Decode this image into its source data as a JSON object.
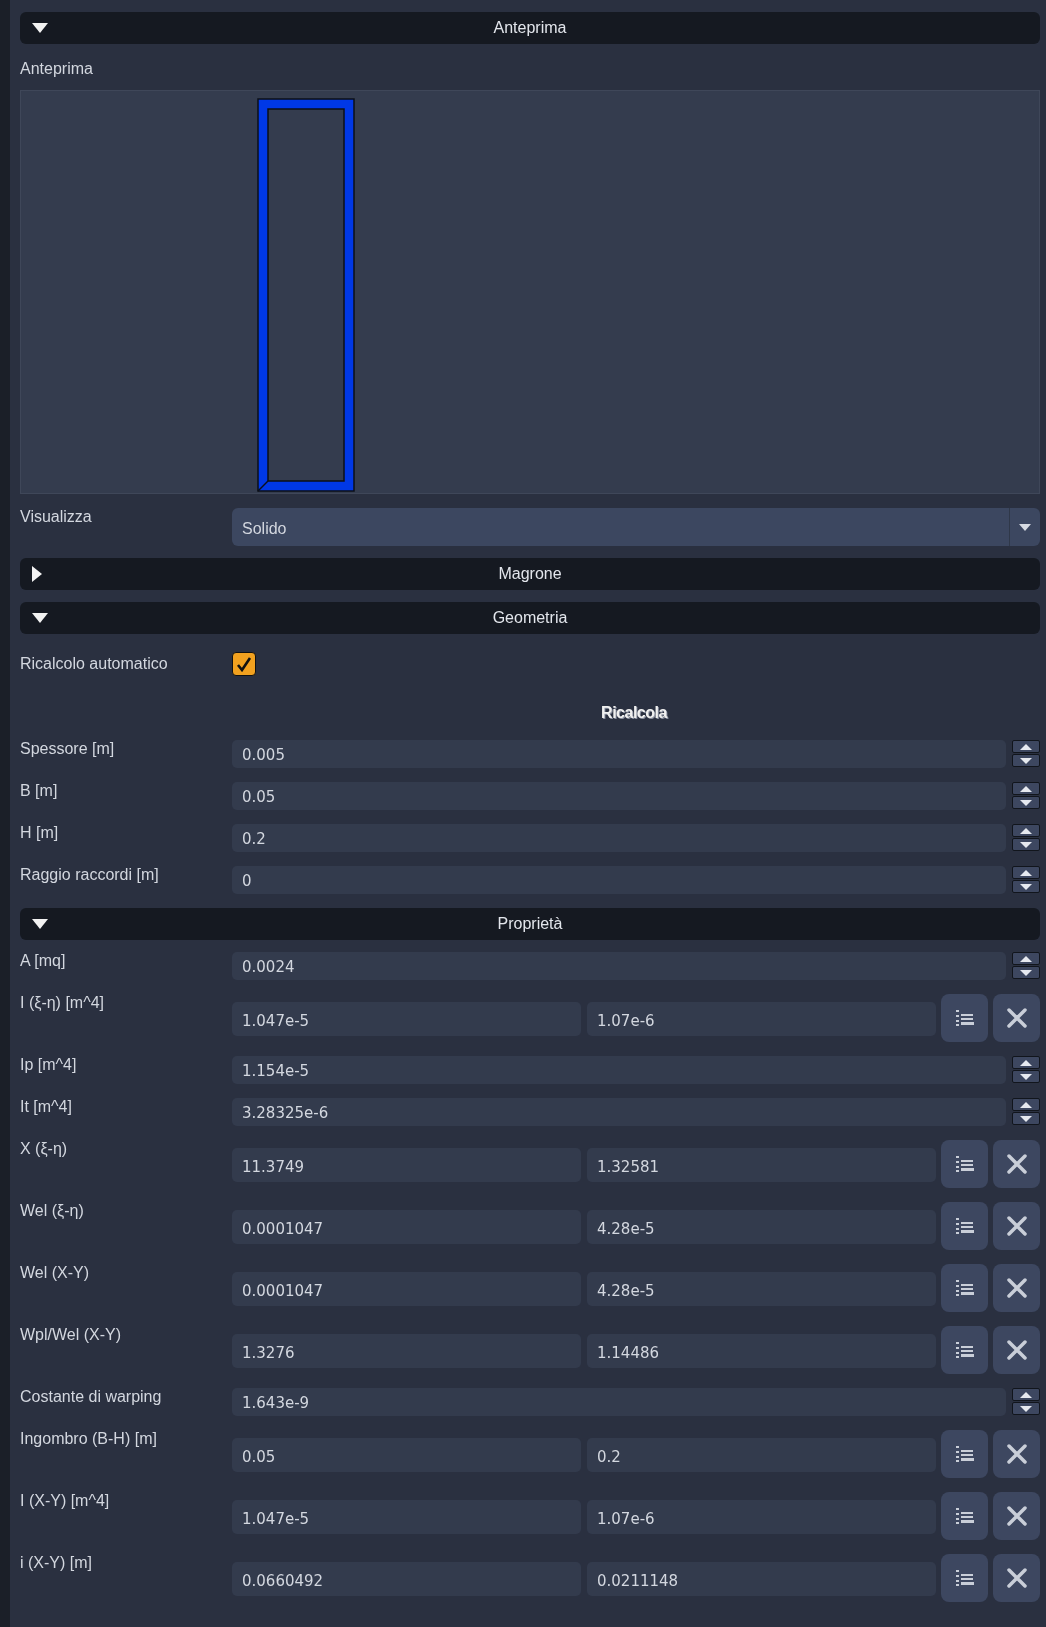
{
  "sections": [
    {
      "title": "Anteprima",
      "expanded": true,
      "rows": [
        {
          "kind": "preview",
          "label": "Anteprima"
        },
        {
          "kind": "combo",
          "label": "Visualizza",
          "value": "Solido"
        }
      ]
    },
    {
      "title": "Magrone",
      "expanded": false
    },
    {
      "title": "Geometria",
      "expanded": true,
      "rows": [
        {
          "kind": "checkbox",
          "label": "Ricalcolo automatico",
          "checked": true
        },
        {
          "kind": "button",
          "label": "Ricalcola"
        },
        {
          "kind": "spin",
          "label": "Spessore [m]",
          "value": "0.005"
        },
        {
          "kind": "spin",
          "label": "B [m]",
          "value": "0.05"
        },
        {
          "kind": "spin",
          "label": "H [m]",
          "value": "0.2"
        },
        {
          "kind": "spin",
          "label": "Raggio raccordi [m]",
          "value": "0"
        }
      ]
    },
    {
      "title": "Proprietà",
      "expanded": true,
      "rows": [
        {
          "kind": "spin",
          "label": "A [mq]",
          "value": "0.0024"
        },
        {
          "kind": "pair",
          "label": "I (ξ-η) [m^4]",
          "values": [
            "1.047e-5",
            "1.07e-6"
          ]
        },
        {
          "kind": "spin",
          "label": "Ip [m^4]",
          "value": "1.154e-5"
        },
        {
          "kind": "spin",
          "label": "It [m^4]",
          "value": "3.28325e-6"
        },
        {
          "kind": "pair",
          "label": "X (ξ-η)",
          "values": [
            "11.3749",
            "1.32581"
          ]
        },
        {
          "kind": "pair",
          "label": "Wel (ξ-η)",
          "values": [
            "0.0001047",
            "4.28e-5"
          ]
        },
        {
          "kind": "pair",
          "label": "Wel (X-Y)",
          "values": [
            "0.0001047",
            "4.28e-5"
          ]
        },
        {
          "kind": "pair",
          "label": "Wpl/Wel (X-Y)",
          "values": [
            "1.3276",
            "1.14486"
          ]
        },
        {
          "kind": "spin",
          "label": "Costante di warping",
          "value": "1.643e-9"
        },
        {
          "kind": "pair",
          "label": "Ingombro (B-H) [m]",
          "values": [
            "0.05",
            "0.2"
          ]
        },
        {
          "kind": "pair",
          "label": "I (X-Y) [m^4]",
          "values": [
            "1.047e-5",
            "1.07e-6"
          ]
        },
        {
          "kind": "pair",
          "label": "i (X-Y) [m]",
          "values": [
            "0.0660492",
            "0.0211148"
          ]
        }
      ]
    }
  ]
}
